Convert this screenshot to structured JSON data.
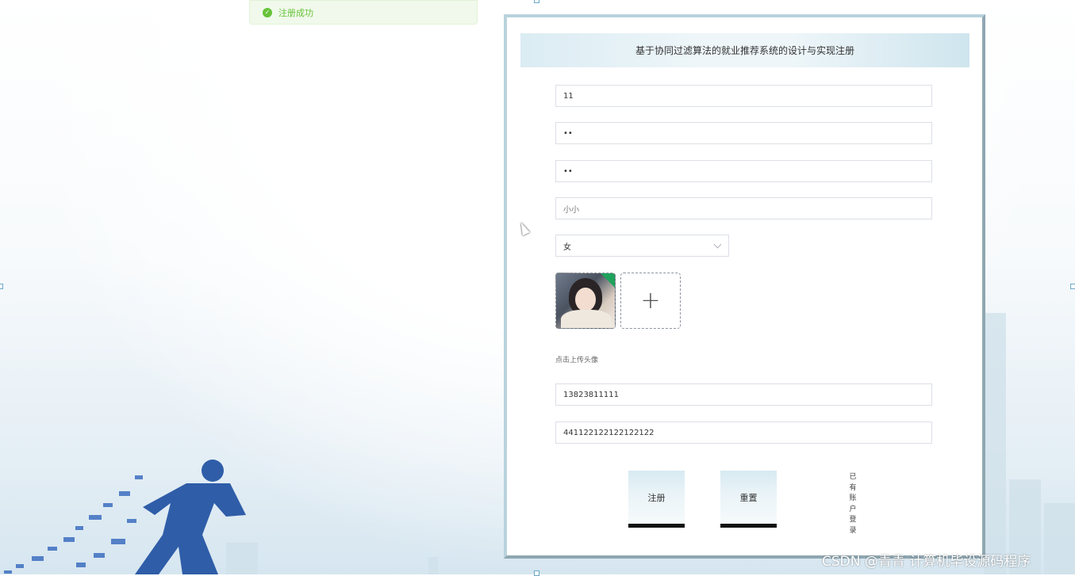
{
  "toast": {
    "text": "注册成功"
  },
  "form": {
    "title": "基于协同过滤算法的就业推荐系统的设计与实现注册",
    "account_value": "11",
    "password_value": "••",
    "confirm_password_value": "••",
    "name_value": "小小",
    "gender_value": "女",
    "avatar_plus": "+",
    "avatar_hint": "点击上传头像",
    "phone_value": "13823811111",
    "id_card_value": "441122122122122122",
    "register_label": "注册",
    "reset_label": "重置",
    "login_link_text": "已有账户登录"
  },
  "watermark": {
    "text": "CSDN @青青  计算机毕设源码程序"
  },
  "colors": {
    "success": "#67c23a",
    "panel_border": "#b9d3dd",
    "button_bg": "#e4f0f5"
  }
}
